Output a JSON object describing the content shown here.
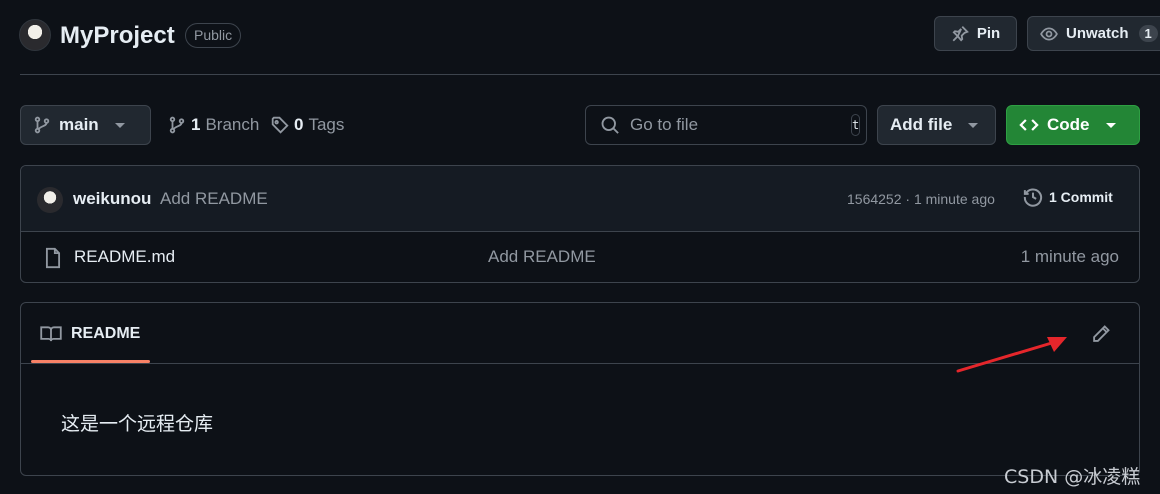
{
  "repo": {
    "name": "MyProject",
    "visibility": "Public"
  },
  "actions": {
    "pin_label": "Pin",
    "unwatch_label": "Unwatch",
    "watch_count": "1"
  },
  "toolbar": {
    "branch_name": "main",
    "branch_count": "1",
    "branch_label": "Branch",
    "tag_count": "0",
    "tag_label": "Tags",
    "search_placeholder": "Go to file",
    "search_shortcut": "t",
    "add_file_label": "Add file",
    "code_label": "Code",
    "code_color": "#238636"
  },
  "latest_commit": {
    "author": "weikunou",
    "message": "Add README",
    "meta": "1564252 · 1 minute ago",
    "commits_label": "1 Commit"
  },
  "files": [
    {
      "name": "README.md",
      "commit_message": "Add README",
      "time": "1 minute ago",
      "icon": "file-icon"
    }
  ],
  "readme": {
    "tab_label": "README",
    "content": "这是一个远程仓库",
    "tab_accent": "#f78166"
  },
  "annotation": {
    "arrow_color": "#e5262b"
  },
  "watermark": "CSDN @冰凌糕"
}
